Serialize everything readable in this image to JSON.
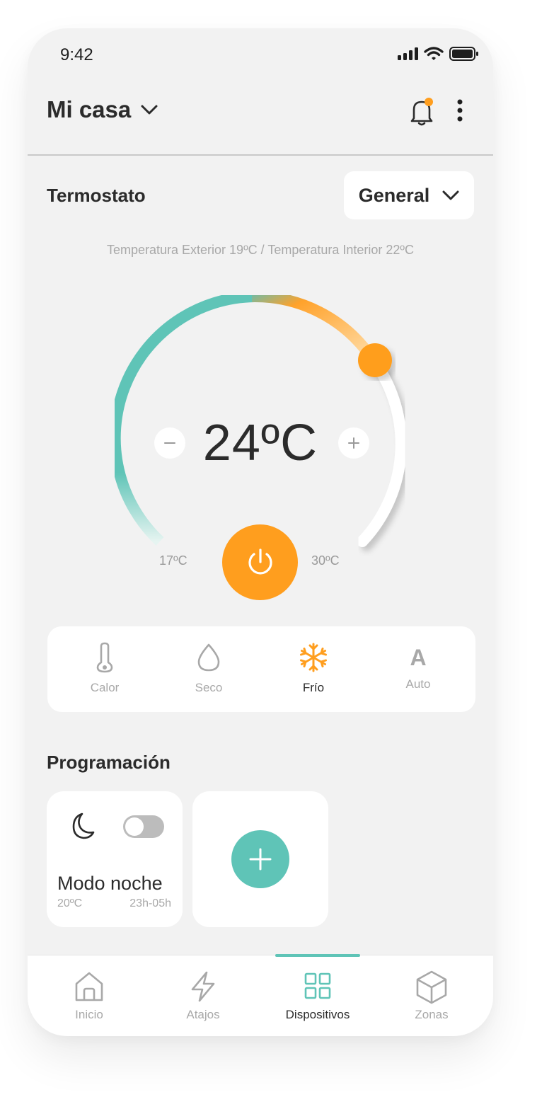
{
  "status_bar": {
    "time": "9:42"
  },
  "header": {
    "home_name": "Mi casa"
  },
  "thermostat": {
    "title": "Termostato",
    "zone_select": "General",
    "temps_info": "Temperatura Exterior 19ºC / Temperatura Interior 22ºC",
    "current_temp": "24ºC",
    "min_label": "17ºC",
    "max_label": "30ºC",
    "range": [
      17,
      30
    ],
    "setpoint": 24
  },
  "modes": [
    {
      "label": "Calor",
      "icon": "thermometer-icon",
      "active": false
    },
    {
      "label": "Seco",
      "icon": "drop-icon",
      "active": false
    },
    {
      "label": "Frío",
      "icon": "snowflake-icon",
      "active": true
    },
    {
      "label": "Auto",
      "icon": "auto-icon",
      "glyph": "A",
      "active": false
    }
  ],
  "schedule": {
    "title": "Programación",
    "cards": [
      {
        "name": "Modo noche",
        "temp": "20ºC",
        "hours": "23h-05h",
        "enabled": false
      }
    ]
  },
  "tabbar": [
    {
      "label": "Inicio",
      "icon": "home-icon",
      "active": false
    },
    {
      "label": "Atajos",
      "icon": "lightning-icon",
      "active": false
    },
    {
      "label": "Dispositivos",
      "icon": "grid-icon",
      "active": true
    },
    {
      "label": "Zonas",
      "icon": "cube-icon",
      "active": false
    }
  ],
  "colors": {
    "accent_orange": "#ff9e1e",
    "accent_teal": "#5fc4b7",
    "background": "#f2f2f2"
  }
}
